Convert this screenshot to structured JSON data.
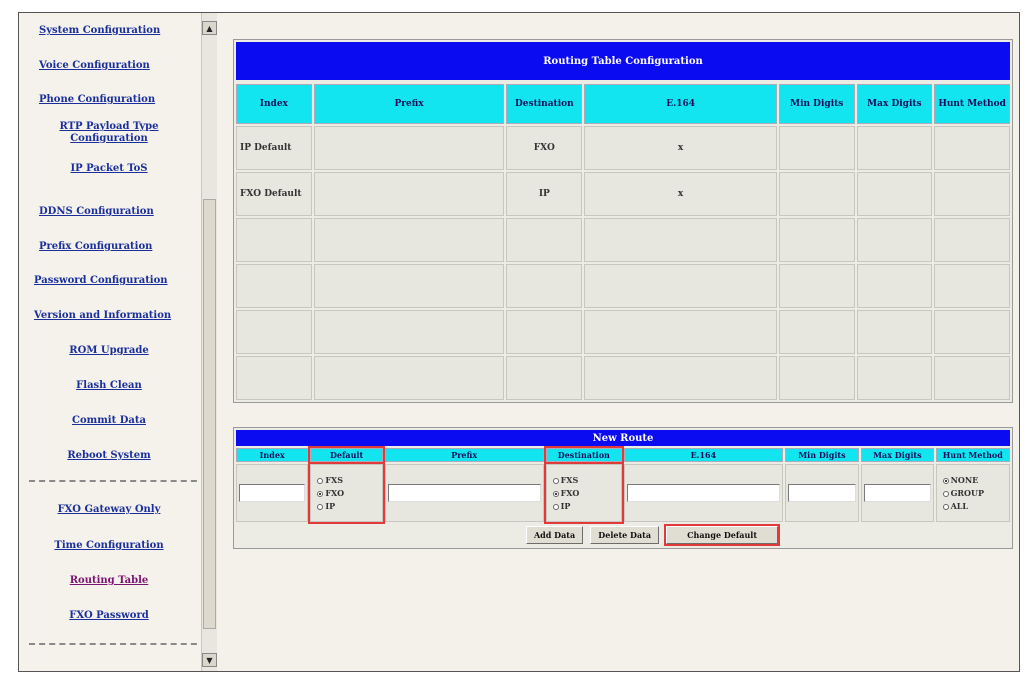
{
  "sidebar": {
    "items": [
      {
        "label": "System Configuration"
      },
      {
        "label": "Voice Configuration"
      },
      {
        "label": "Phone Configuration"
      },
      {
        "label": "RTP Payload Type Configuration"
      },
      {
        "label": "IP Packet ToS"
      },
      {
        "label": "DDNS Configuration"
      },
      {
        "label": "Prefix Configuration"
      },
      {
        "label": "Password Configuration"
      },
      {
        "label": "Version and Information"
      },
      {
        "label": "ROM Upgrade"
      },
      {
        "label": "Flash Clean"
      },
      {
        "label": "Commit Data"
      },
      {
        "label": "Reboot System"
      },
      {
        "label": "FXO Gateway Only"
      },
      {
        "label": "Time Configuration"
      },
      {
        "label": "Routing Table"
      },
      {
        "label": "FXO Password"
      }
    ],
    "active": "Routing Table"
  },
  "routing_table": {
    "title": "Routing Table Configuration",
    "headers": [
      "Index",
      "Prefix",
      "Destination",
      "E.164",
      "Min Digits",
      "Max Digits",
      "Hunt Method"
    ],
    "rows": [
      [
        "IP Default",
        "",
        "FXO",
        "x",
        "",
        "",
        ""
      ],
      [
        "FXO Default",
        "",
        "IP",
        "x",
        "",
        "",
        ""
      ],
      [
        "",
        "",
        "",
        "",
        "",
        "",
        ""
      ],
      [
        "",
        "",
        "",
        "",
        "",
        "",
        ""
      ],
      [
        "",
        "",
        "",
        "",
        "",
        "",
        ""
      ],
      [
        "",
        "",
        "",
        "",
        "",
        "",
        ""
      ]
    ]
  },
  "new_route": {
    "title": "New Route",
    "headers": [
      "Index",
      "Default",
      "Prefix",
      "Destination",
      "E.164",
      "Min Digits",
      "Max Digits",
      "Hunt Method"
    ],
    "default_options": [
      "FXS",
      "FXO",
      "IP"
    ],
    "default_selected": "FXO",
    "destination_options": [
      "FXS",
      "FXO",
      "IP"
    ],
    "destination_selected": "FXO",
    "hunt_options": [
      "NONE",
      "GROUP",
      "ALL"
    ],
    "hunt_selected": "NONE",
    "buttons": {
      "add": "Add Data",
      "delete": "Delete Data",
      "change_default": "Change Default"
    }
  },
  "colors": {
    "title_bar": "#0b0bf2",
    "header_cell": "#12e4f0",
    "link": "#1b2f9c",
    "active_link": "#7b1370",
    "highlight": "#e03a3a"
  }
}
